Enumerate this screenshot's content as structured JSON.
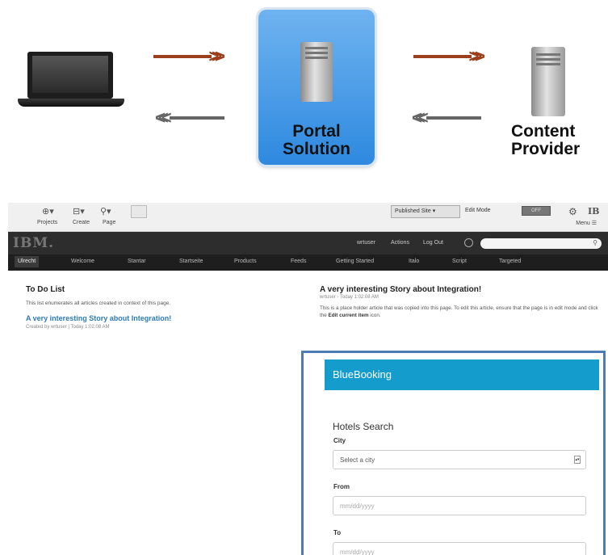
{
  "diagram": {
    "portal_label_line1": "Portal",
    "portal_label_line2": "Solution",
    "content_label_line1": "Content",
    "content_label_line2": "Provider",
    "arrow_out_color": "#9c3f1c",
    "arrow_in_color": "#666666",
    "portal_color": "#2e89df"
  },
  "toolbar": {
    "labels": [
      "Projects",
      "Create",
      "Page"
    ],
    "site_select": "Published Site",
    "edit_mode_label": "Edit Mode",
    "toggle_label": "OFF",
    "menu_label": "Menu"
  },
  "banner": {
    "logo": "IBM.",
    "links": [
      "wrtuser",
      "Actions",
      "Log Out"
    ],
    "search_placeholder": ""
  },
  "nav": {
    "items": [
      "Ulrecht",
      "Welcome",
      "Stantar",
      "Startseite",
      "Products",
      "Feeds",
      "Getting Started",
      "Italo",
      "Script",
      "Targeted"
    ]
  },
  "todo": {
    "title": "To Do List",
    "description": "This list enumerates all articles created in context of this page.",
    "link": "A very interesting Story about Integration!",
    "meta": "Created by wrtuser  |  Today 1:02:08 AM"
  },
  "story": {
    "title": "A very interesting Story about Integration!",
    "meta": "wrtuser - Today 1:02:08 AM",
    "body_1": "This is a place holder article that was copied into this page. To edit this article, ensure that the page is in edit mode and click the ",
    "body_bold": "Edit current item",
    "body_2": " icon."
  },
  "bluebooking": {
    "title": "BlueBooking",
    "search_heading": "Hotels Search",
    "city_label": "City",
    "city_value": "Select a city",
    "from_label": "From",
    "from_placeholder": "mm/dd/yyyy",
    "to_label": "To",
    "to_placeholder": "mm/dd/yyyy",
    "accent_color": "#149ccd"
  }
}
